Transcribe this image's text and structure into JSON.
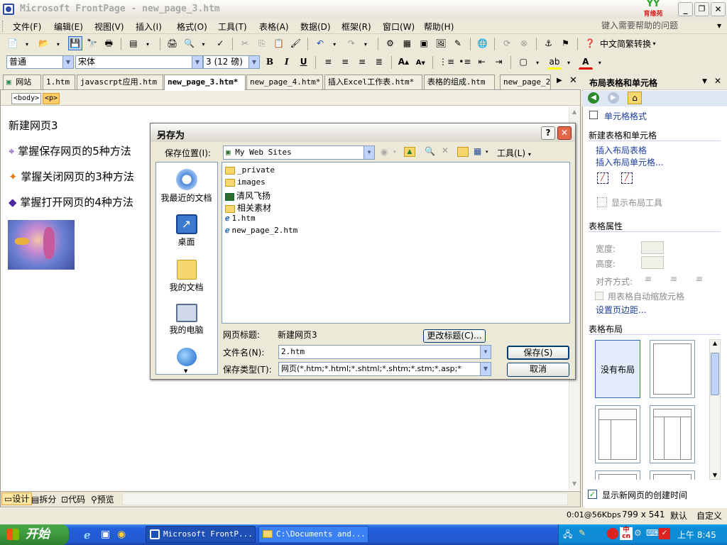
{
  "window": {
    "title": "Microsoft FrontPage - new_page_3.htm",
    "logo_text": "育缘苑"
  },
  "menu": [
    "文件(F)",
    "编辑(E)",
    "视图(V)",
    "插入(I)",
    "格式(O)",
    "工具(T)",
    "表格(A)",
    "数据(D)",
    "框架(R)",
    "窗口(W)",
    "帮助(H)"
  ],
  "help_box": {
    "placeholder": "键入需要帮助的问题"
  },
  "toolbar": {
    "convert_label": "中文简繁转换"
  },
  "format_bar": {
    "style": "普通",
    "font": "宋体",
    "size": "3 (12 磅)"
  },
  "tabs": [
    "网站",
    "1.htm",
    "javascrpt应用.htm",
    "new_page_3.htm*",
    "new_page_4.htm*",
    "插入Excel工作表.htm*",
    "表格的组成.htm",
    "new_page_2"
  ],
  "tag_path": [
    "<body>",
    "<p>"
  ],
  "doc": {
    "heading": "新建网页3",
    "items": [
      "掌握保存网页的5种方法",
      "掌握关闭网页的3种方法",
      "掌握打开网页的4种方法"
    ]
  },
  "dialog": {
    "title": "另存为",
    "save_in_label": "保存位置(I):",
    "save_in_value": "My Web Sites",
    "tools_label": "工具(L)",
    "places": [
      "我最近的文档",
      "桌面",
      "我的文档",
      "我的电脑"
    ],
    "files": [
      "_private",
      "images",
      "清风飞扬",
      "相关素材",
      "1.htm",
      "new_page_2.htm"
    ],
    "page_title_label": "网页标题:",
    "page_title_value": "新建网页3",
    "change_title_button": "更改标题(C)...",
    "filename_label": "文件名(N):",
    "filename_value": "2.htm",
    "filetype_label": "保存类型(T):",
    "filetype_value": "网页(*.htm;*.html;*.shtml;*.shtm;*.stm;*.asp;*",
    "save_button": "保存(S)",
    "cancel_button": "取消"
  },
  "view_tabs": [
    "设计",
    "拆分",
    "代码",
    "预览"
  ],
  "statusbar": {
    "speed": "0:01@56Kbps",
    "dims": "799 x 541",
    "default": "默认",
    "custom": "自定义"
  },
  "taskpane": {
    "title": "布局表格和单元格",
    "cell_format": "单元格格式",
    "new_section": "新建表格和单元格",
    "insert_table": "插入布局表格",
    "insert_cell": "插入布局单元格...",
    "show_tools": "显示布局工具",
    "props_section": "表格属性",
    "width_label": "宽度:",
    "height_label": "高度:",
    "align_label": "对齐方式:",
    "autoscale": "用表格自动缩放元格",
    "margins_link": "设置页边距...",
    "layout_section": "表格布局",
    "no_layout": "没有布局",
    "show_creation": "显示新网页的创建时间"
  },
  "taskbar": {
    "start": "开始",
    "tasks": [
      "Microsoft FrontP...",
      "C:\\Documents and..."
    ],
    "clock": "上午 8:45"
  }
}
